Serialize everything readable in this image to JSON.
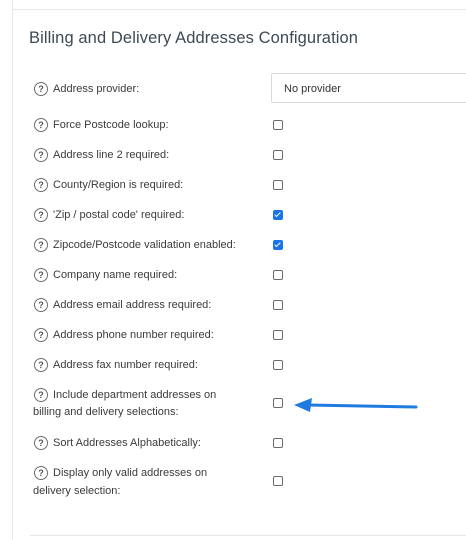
{
  "section": {
    "title": "Billing and Delivery Addresses Configuration"
  },
  "address_provider": {
    "label": "Address provider:",
    "selected": "No provider"
  },
  "settings": [
    {
      "label": "Force Postcode lookup:",
      "checked": false
    },
    {
      "label": "Address line 2 required:",
      "checked": false
    },
    {
      "label": "County/Region is required:",
      "checked": false
    },
    {
      "label": "'Zip / postal code' required:",
      "checked": true
    },
    {
      "label": "Zipcode/Postcode validation enabled:",
      "checked": true
    },
    {
      "label": "Company name required:",
      "checked": false
    },
    {
      "label": "Address email address required:",
      "checked": false
    },
    {
      "label": "Address phone number required:",
      "checked": false
    },
    {
      "label": "Address fax number required:",
      "checked": false
    },
    {
      "label_line1": "Include department addresses on",
      "label_line2": "billing and delivery selections:",
      "checked": false
    },
    {
      "label": "Sort Addresses Alphabetically:",
      "checked": false
    },
    {
      "label_line1": "Display only valid addresses on",
      "label_line2": "delivery selection:",
      "checked": false
    }
  ],
  "help_icon_glyph": "?",
  "annotation": {
    "icon": "arrow-left-icon",
    "color": "#1f7be0"
  }
}
